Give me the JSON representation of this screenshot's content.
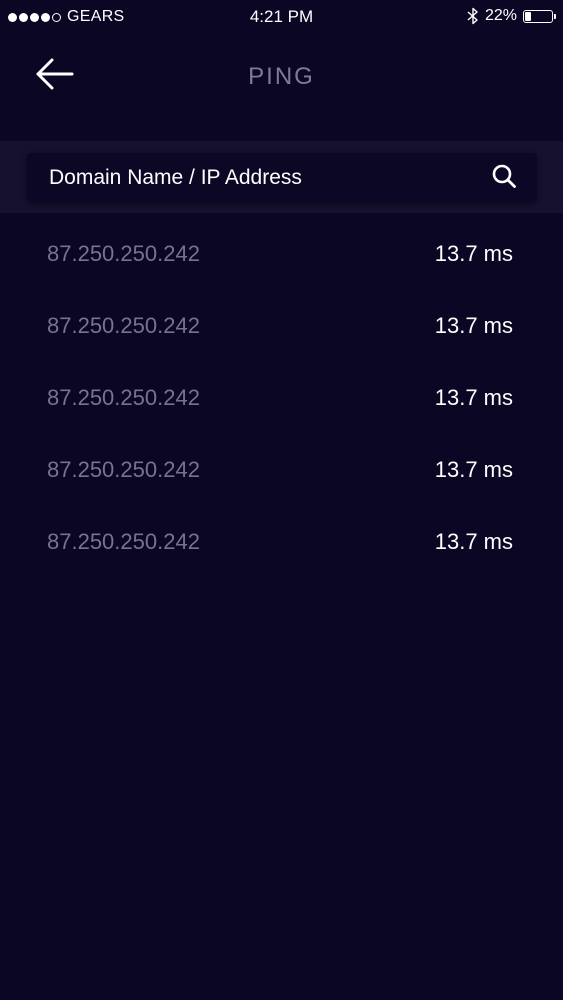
{
  "status_bar": {
    "signal_bars_filled": 4,
    "signal_bars_total": 5,
    "carrier": "GEARS",
    "time": "4:21 PM",
    "bluetooth_icon": "bluetooth-icon",
    "battery_percent_label": "22%",
    "battery_level": 0.22
  },
  "nav": {
    "back_icon": "arrow-left-icon",
    "title": "PING"
  },
  "search": {
    "placeholder": "Domain Name / IP Address",
    "value": "",
    "icon": "search-icon"
  },
  "results": [
    {
      "ip": "87.250.250.242",
      "latency": "13.7 ms"
    },
    {
      "ip": "87.250.250.242",
      "latency": "13.7 ms"
    },
    {
      "ip": "87.250.250.242",
      "latency": "13.7 ms"
    },
    {
      "ip": "87.250.250.242",
      "latency": "13.7 ms"
    },
    {
      "ip": "87.250.250.242",
      "latency": "13.7 ms"
    }
  ],
  "colors": {
    "background": "#0a0624",
    "search_band": "#15112f",
    "search_box": "#0b0725",
    "muted_text": "#77738d",
    "title_text": "#7f7b96",
    "primary_text": "#ffffff"
  }
}
